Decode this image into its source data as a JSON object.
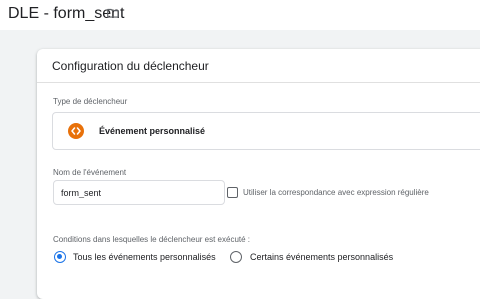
{
  "header": {
    "trigger_name": "DLE - form_sent",
    "folder_icon": "folder-icon"
  },
  "card": {
    "title": "Configuration du déclencheur",
    "trigger_type": {
      "label": "Type de déclencheur",
      "value": "Événement personnalisé",
      "icon": "custom-event-icon",
      "icon_color": "#e8710a"
    },
    "event_name": {
      "label": "Nom de l'événement",
      "value": "form_sent"
    },
    "regex": {
      "label": "Utiliser la correspondance avec expression régulière",
      "checked": false
    },
    "conditions": {
      "label": "Conditions dans lesquelles le déclencheur est exécuté :",
      "options": [
        {
          "label": "Tous les événements personnalisés",
          "selected": true
        },
        {
          "label": "Certains événements personnalisés",
          "selected": false
        }
      ]
    }
  },
  "colors": {
    "accent": "#1a73e8",
    "background": "#f1f3f4"
  }
}
